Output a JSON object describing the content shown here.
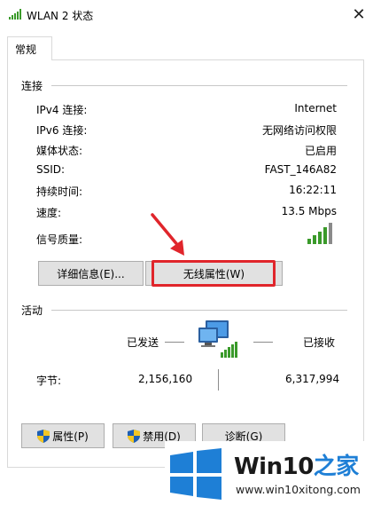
{
  "window": {
    "title": "WLAN 2 状态"
  },
  "tabs": [
    {
      "label": "常规"
    }
  ],
  "connection": {
    "section_label": "连接",
    "rows": [
      {
        "label": "IPv4 连接:",
        "value": "Internet"
      },
      {
        "label": "IPv6 连接:",
        "value": "无网络访问权限"
      },
      {
        "label": "媒体状态:",
        "value": "已启用"
      },
      {
        "label": "SSID:",
        "value": "FAST_146A82"
      },
      {
        "label": "持续时间:",
        "value": "16:22:11"
      },
      {
        "label": "速度:",
        "value": "13.5 Mbps"
      }
    ],
    "signal_label": "信号质量:",
    "signal_bars": 5,
    "details_button": "详细信息(E)...",
    "wireless_props_button": "无线属性(W)"
  },
  "activity": {
    "section_label": "活动",
    "sent_label": "已发送",
    "received_label": "已接收",
    "bytes_label": "字节:",
    "bytes_sent": "2,156,160",
    "bytes_received": "6,317,994"
  },
  "buttons": {
    "properties": "属性(P)",
    "disable": "禁用(D)",
    "diagnose": "诊断(G)"
  },
  "watermark": {
    "brand_prefix": "Win10",
    "brand_suffix": "之家",
    "url": "www.win10xitong.com"
  },
  "colors": {
    "signal_green": "#3a9a2a",
    "highlight_red": "#e0252b",
    "win_blue": "#1e7fd6"
  }
}
